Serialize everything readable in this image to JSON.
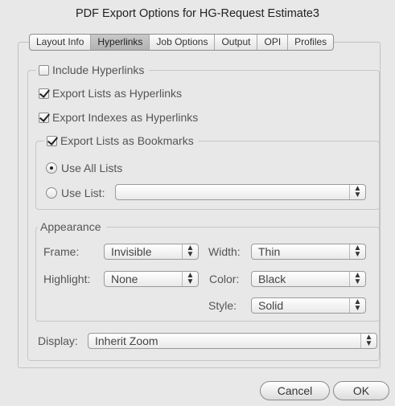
{
  "window": {
    "title": "PDF Export Options for HG-Request Estimate3"
  },
  "tabs": [
    {
      "label": "Layout Info",
      "active": false
    },
    {
      "label": "Hyperlinks",
      "active": true
    },
    {
      "label": "Job Options",
      "active": false
    },
    {
      "label": "Output",
      "active": false
    },
    {
      "label": "OPI",
      "active": false
    },
    {
      "label": "Profiles",
      "active": false
    }
  ],
  "hyperlinks": {
    "include_label": "Include Hyperlinks",
    "include_checked": false,
    "export_lists_label": "Export Lists as Hyperlinks",
    "export_lists_checked": true,
    "export_indexes_label": "Export Indexes as Hyperlinks",
    "export_indexes_checked": true,
    "bookmarks": {
      "label": "Export Lists as Bookmarks",
      "checked": true,
      "use_all_lists": "Use All Lists",
      "use_all_selected": true,
      "use_list": "Use List:",
      "use_list_value": ""
    },
    "appearance": {
      "label": "Appearance",
      "frame_label": "Frame:",
      "frame_value": "Invisible",
      "width_label": "Width:",
      "width_value": "Thin",
      "highlight_label": "Highlight:",
      "highlight_value": "None",
      "color_label": "Color:",
      "color_value": "Black",
      "style_label": "Style:",
      "style_value": "Solid"
    },
    "display_label": "Display:",
    "display_value": "Inherit Zoom"
  },
  "buttons": {
    "cancel": "Cancel",
    "ok": "OK"
  }
}
